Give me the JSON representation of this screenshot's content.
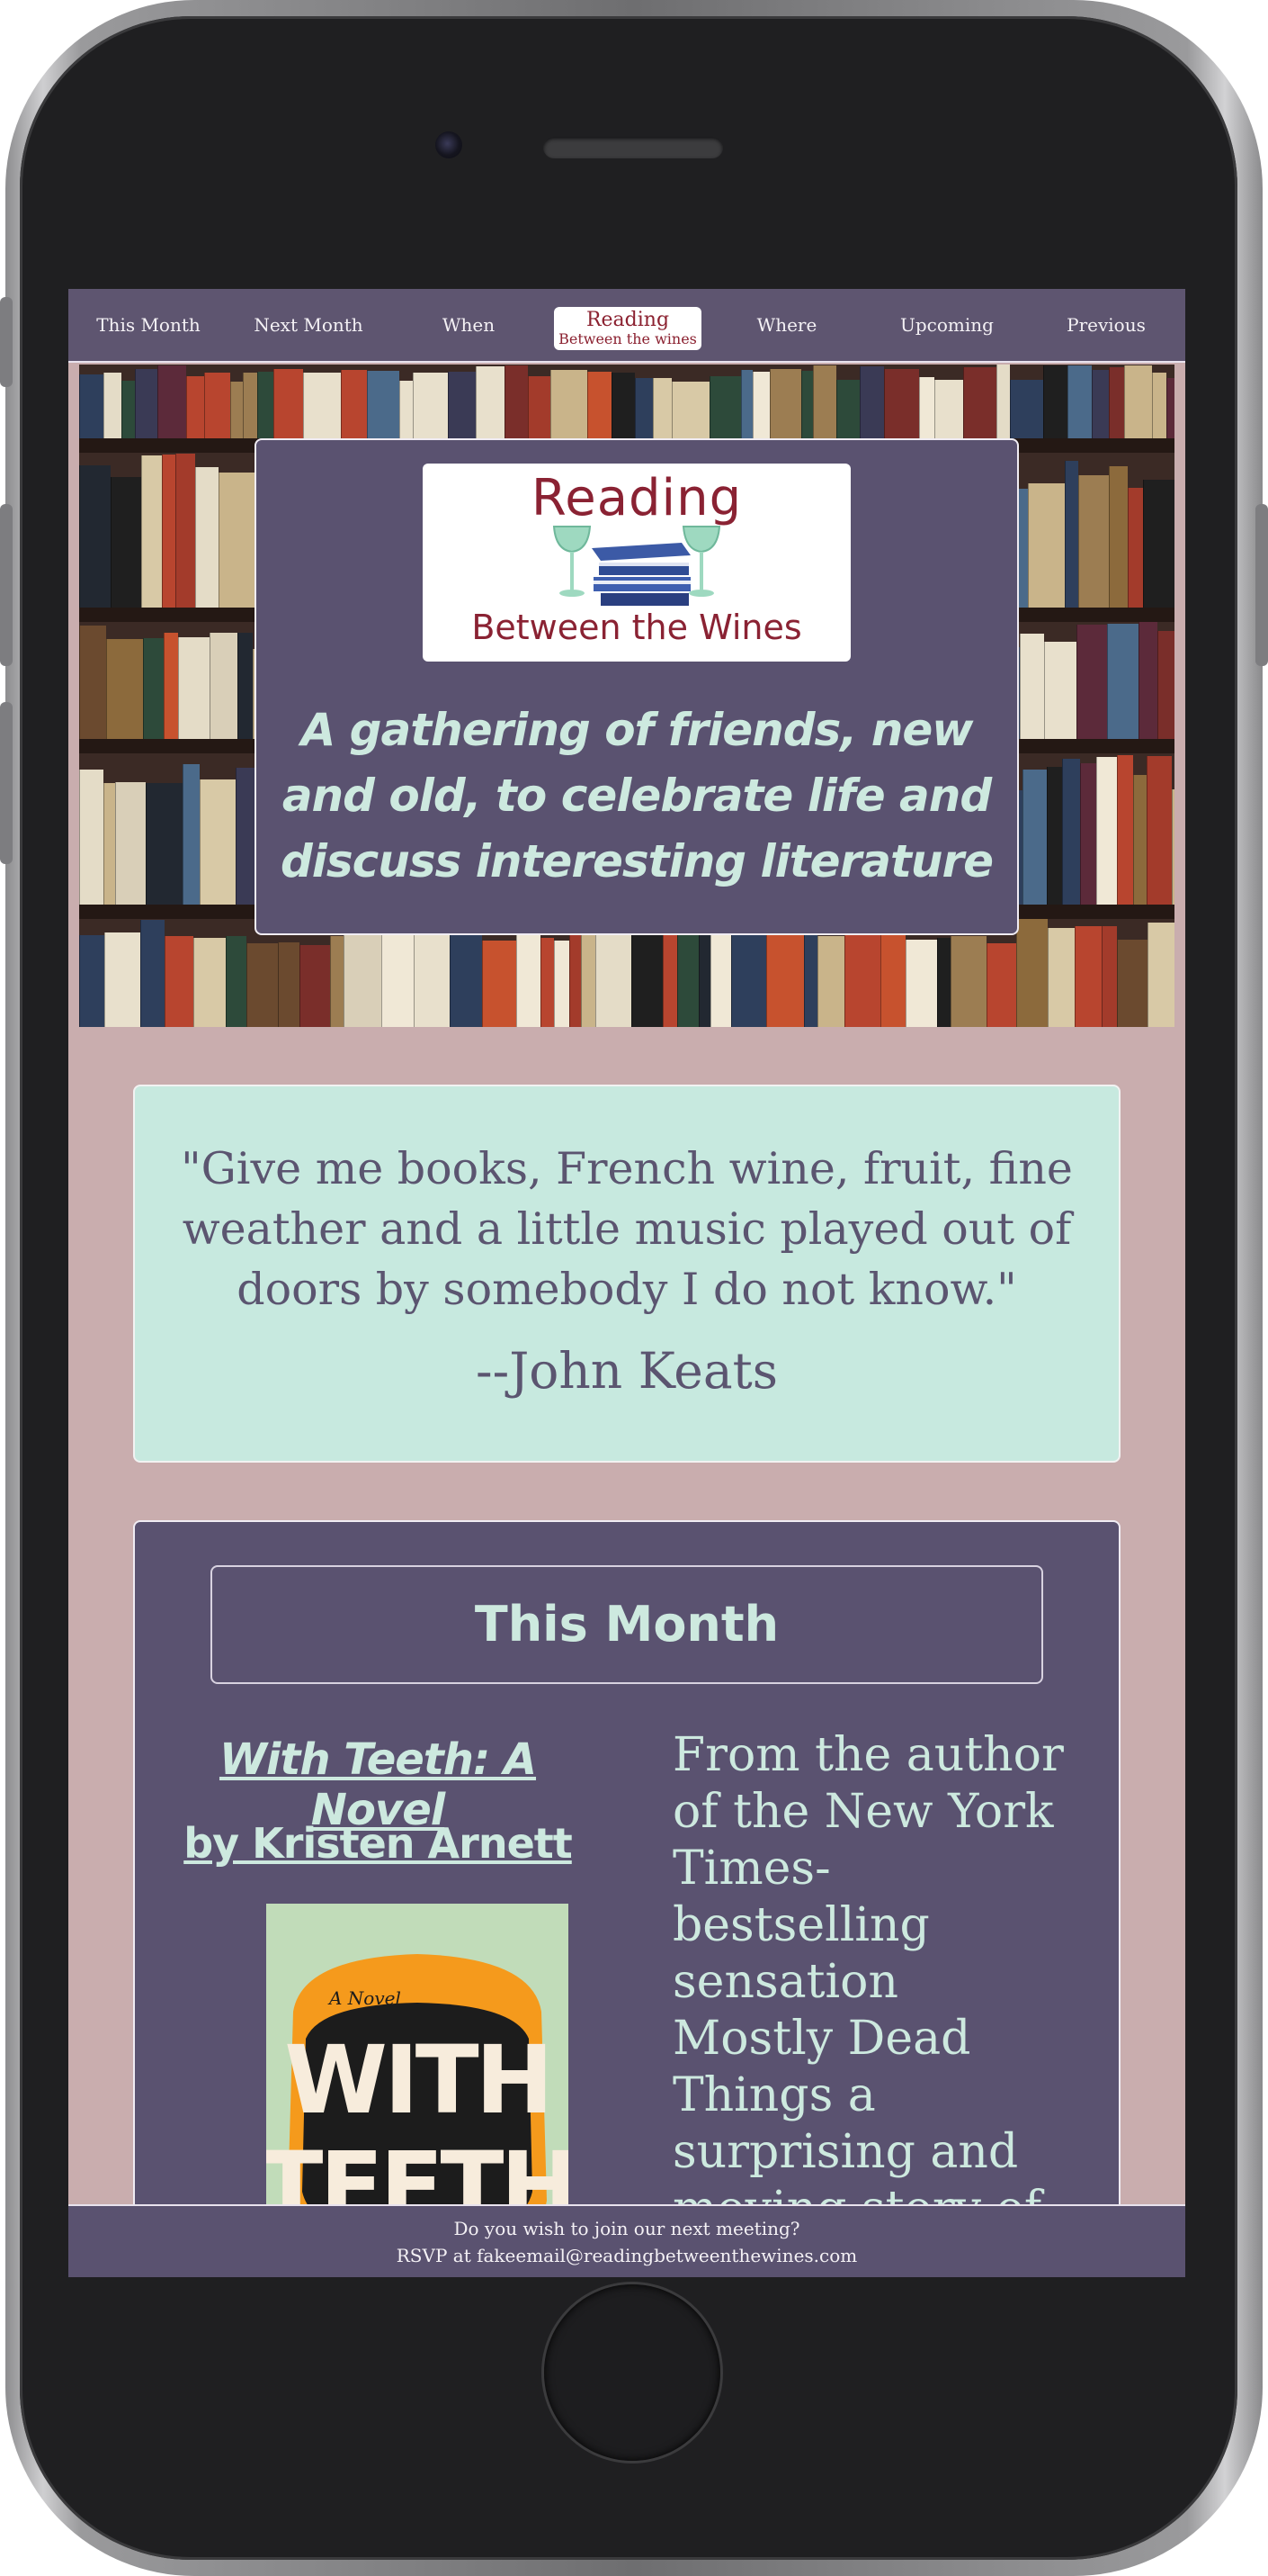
{
  "nav": {
    "items": [
      "This Month",
      "Next Month",
      "When",
      "Where",
      "Upcoming",
      "Previous"
    ],
    "logo_line1": "Reading",
    "logo_line2": "Between the wines"
  },
  "hero": {
    "logo_title": "Reading",
    "logo_subtitle": "Between the Wines",
    "tagline": "A gathering of friends, new and old, to celebrate life and discuss interesting literature"
  },
  "quote": {
    "text": "\"Give me books, French wine, fruit, fine weather and a little music played out of doors by somebody I do not know.\"",
    "author": "--John Keats"
  },
  "this_month": {
    "heading": "This Month",
    "book_title": "With Teeth: A Novel",
    "book_author": "by Kristen Arnett",
    "cover_small": "A Novel",
    "cover_line1": "WITH",
    "cover_line2": "TEETH",
    "description": "From the author of the New York Times-bestselling sensation Mostly Dead Things a surprising and moving story of"
  },
  "footer": {
    "line1": "Do you wish to join our next meeting?",
    "line2": "RSVP at fakeemail@readingbetweenthewines.com"
  },
  "colors": {
    "nav_bg": "#5e5570",
    "card_bg": "#5a5270",
    "mint": "#cde9df",
    "quote_bg": "#c7e9df",
    "page_bg": "#c9adae",
    "wine": "#8a2233"
  }
}
